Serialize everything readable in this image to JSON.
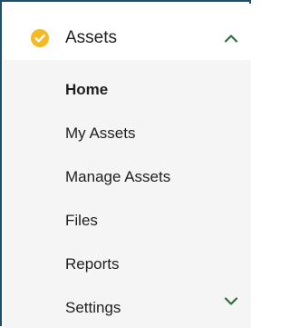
{
  "header": {
    "label": "Assets",
    "status_icon": "check-circle-icon",
    "status_color": "#f5b921",
    "toggle_icon": "chevron-up-icon",
    "expanded": true
  },
  "submenu": {
    "items": [
      {
        "label": "Home",
        "active": true
      },
      {
        "label": "My Assets",
        "active": false
      },
      {
        "label": "Manage Assets",
        "active": false
      },
      {
        "label": "Files",
        "active": false
      },
      {
        "label": "Reports",
        "active": false
      },
      {
        "label": "Settings",
        "active": false,
        "trailing_icon": "chevron-down-icon"
      }
    ]
  },
  "colors": {
    "frame_border": "#1e4e6e",
    "submenu_background": "#f5f5f5",
    "text": "#1f1f1f",
    "chevron": "#2f6f3e"
  }
}
